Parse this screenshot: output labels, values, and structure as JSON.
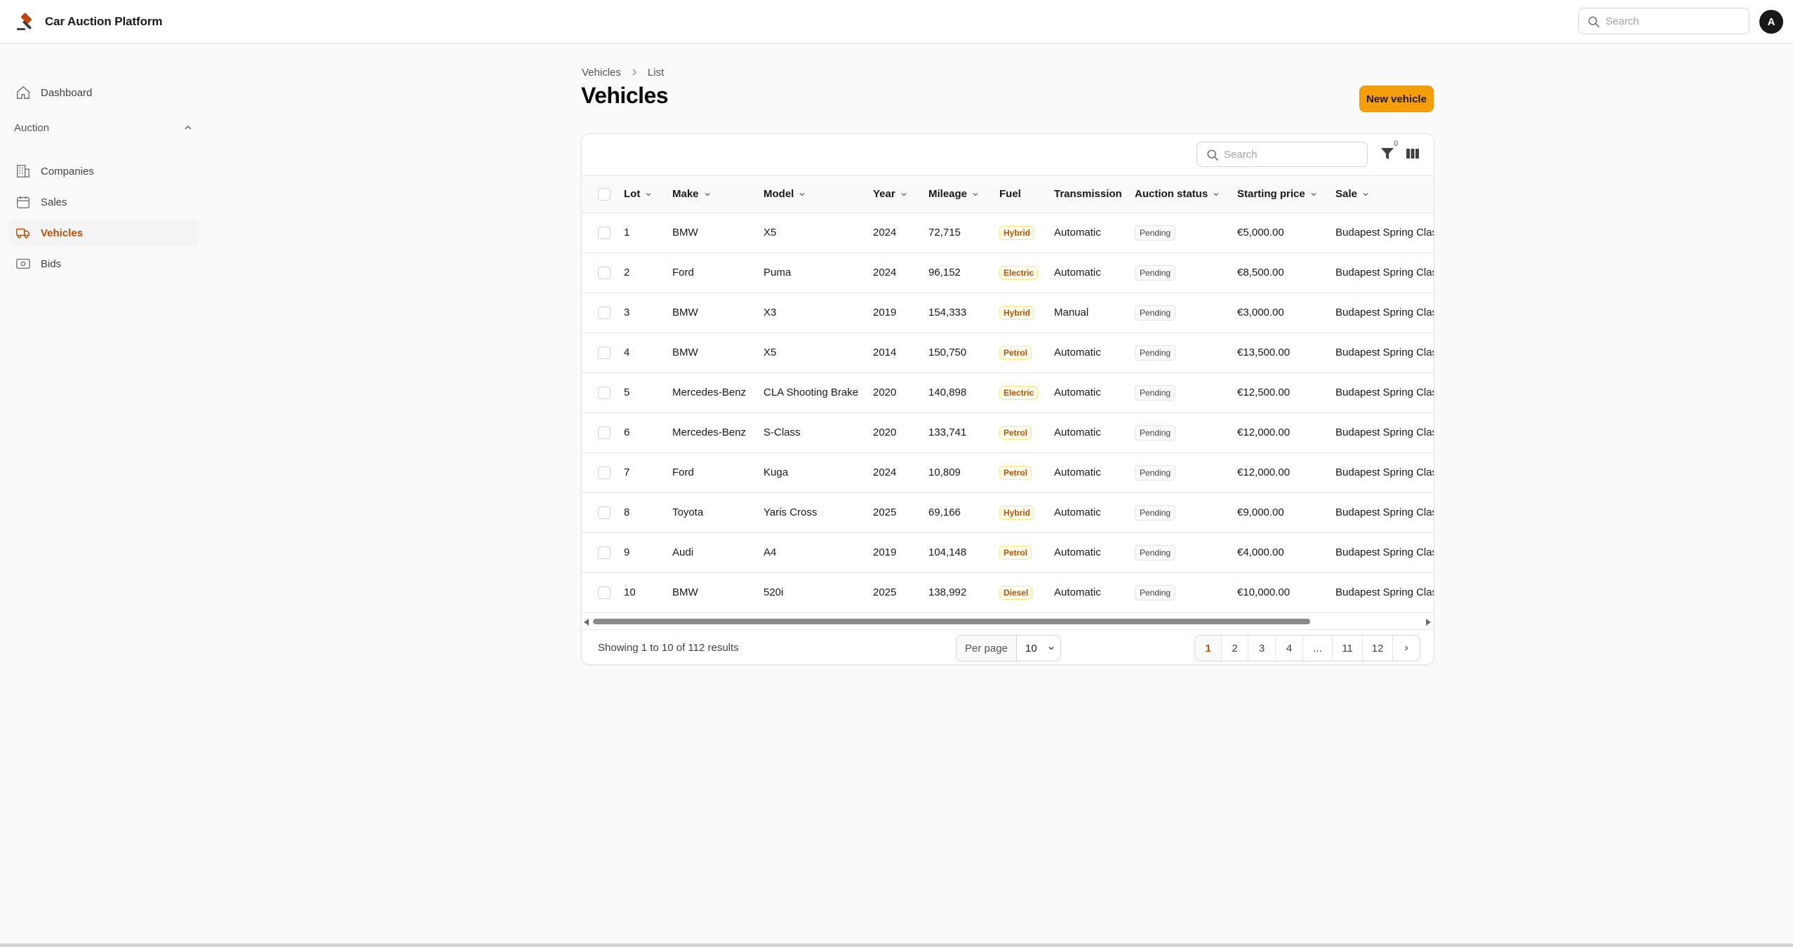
{
  "app": {
    "title": "Car Auction Platform",
    "avatar_initial": "A",
    "accent": "#f59e0b"
  },
  "topbar": {
    "search_placeholder": "Search"
  },
  "sidebar": {
    "dashboard": {
      "label": "Dashboard",
      "icon": "home-icon"
    },
    "group": {
      "label": "Auction",
      "icon": "chevron-up-icon"
    },
    "items": [
      {
        "label": "Companies",
        "icon": "building-icon"
      },
      {
        "label": "Sales",
        "icon": "calendar-icon"
      },
      {
        "label": "Vehicles",
        "icon": "truck-icon",
        "active": true
      },
      {
        "label": "Bids",
        "icon": "banknote-icon"
      }
    ]
  },
  "breadcrumb": {
    "items": [
      "Vehicles",
      "List"
    ]
  },
  "page": {
    "title": "Vehicles",
    "new_button": "New vehicle"
  },
  "table": {
    "search_placeholder": "Search",
    "filter_count": "0",
    "columns": [
      "Lot",
      "Make",
      "Model",
      "Year",
      "Mileage",
      "Fuel",
      "Transmission",
      "Auction status",
      "Starting price",
      "Sale"
    ],
    "rows": [
      {
        "lot": "1",
        "make": "BMW",
        "model": "X5",
        "year": "2024",
        "mileage": "72,715",
        "fuel": "Hybrid",
        "transmission": "Automatic",
        "status": "Pending",
        "price": "€5,000.00",
        "sale": "Budapest Spring Clas"
      },
      {
        "lot": "2",
        "make": "Ford",
        "model": "Puma",
        "year": "2024",
        "mileage": "96,152",
        "fuel": "Electric",
        "transmission": "Automatic",
        "status": "Pending",
        "price": "€8,500.00",
        "sale": "Budapest Spring Clas"
      },
      {
        "lot": "3",
        "make": "BMW",
        "model": "X3",
        "year": "2019",
        "mileage": "154,333",
        "fuel": "Hybrid",
        "transmission": "Manual",
        "status": "Pending",
        "price": "€3,000.00",
        "sale": "Budapest Spring Clas"
      },
      {
        "lot": "4",
        "make": "BMW",
        "model": "X5",
        "year": "2014",
        "mileage": "150,750",
        "fuel": "Petrol",
        "transmission": "Automatic",
        "status": "Pending",
        "price": "€13,500.00",
        "sale": "Budapest Spring Clas"
      },
      {
        "lot": "5",
        "make": "Mercedes-Benz",
        "model": "CLA Shooting Brake",
        "year": "2020",
        "mileage": "140,898",
        "fuel": "Electric",
        "transmission": "Automatic",
        "status": "Pending",
        "price": "€12,500.00",
        "sale": "Budapest Spring Clas"
      },
      {
        "lot": "6",
        "make": "Mercedes-Benz",
        "model": "S-Class",
        "year": "2020",
        "mileage": "133,741",
        "fuel": "Petrol",
        "transmission": "Automatic",
        "status": "Pending",
        "price": "€12,000.00",
        "sale": "Budapest Spring Clas"
      },
      {
        "lot": "7",
        "make": "Ford",
        "model": "Kuga",
        "year": "2024",
        "mileage": "10,809",
        "fuel": "Petrol",
        "transmission": "Automatic",
        "status": "Pending",
        "price": "€12,000.00",
        "sale": "Budapest Spring Clas"
      },
      {
        "lot": "8",
        "make": "Toyota",
        "model": "Yaris Cross",
        "year": "2025",
        "mileage": "69,166",
        "fuel": "Hybrid",
        "transmission": "Automatic",
        "status": "Pending",
        "price": "€9,000.00",
        "sale": "Budapest Spring Clas"
      },
      {
        "lot": "9",
        "make": "Audi",
        "model": "A4",
        "year": "2019",
        "mileage": "104,148",
        "fuel": "Petrol",
        "transmission": "Automatic",
        "status": "Pending",
        "price": "€4,000.00",
        "sale": "Budapest Spring Clas"
      },
      {
        "lot": "10",
        "make": "BMW",
        "model": "520i",
        "year": "2025",
        "mileage": "138,992",
        "fuel": "Diesel",
        "transmission": "Automatic",
        "status": "Pending",
        "price": "€10,000.00",
        "sale": "Budapest Spring Clas"
      }
    ]
  },
  "footer": {
    "showing": "Showing 1 to 10 of 112 results",
    "per_page_label": "Per page",
    "per_page_value": "10",
    "pages": [
      "1",
      "2",
      "3",
      "4",
      "...",
      "11",
      "12"
    ],
    "current_page": "1"
  }
}
